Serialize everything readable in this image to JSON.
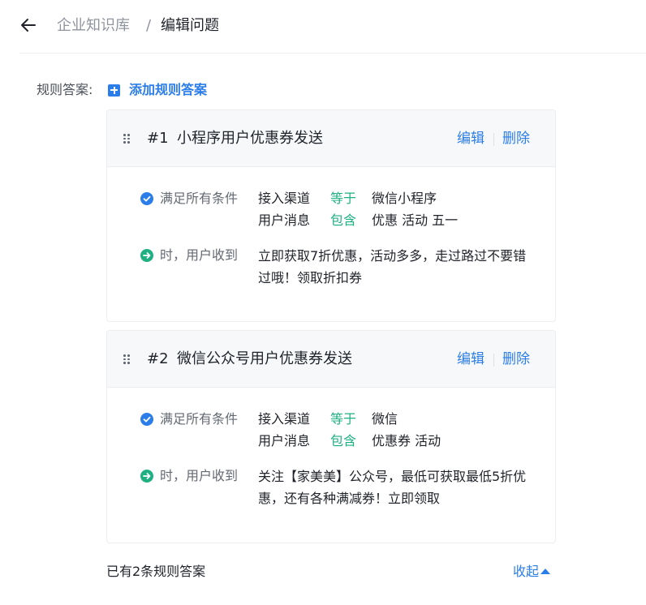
{
  "header": {
    "breadcrumb_root": "企业知识库",
    "breadcrumb_sep": "/",
    "breadcrumb_current": "编辑问题"
  },
  "rules": {
    "label": "规则答案:",
    "add_label": "添加规则答案",
    "items": [
      {
        "num": "#1",
        "title": "小程序用户优惠券发送",
        "edit_label": "编辑",
        "delete_label": "删除",
        "condition_label": "满足所有条件",
        "conditions": [
          {
            "field": "接入渠道",
            "op": "等于",
            "value": "微信小程序"
          },
          {
            "field": "用户消息",
            "op": "包含",
            "value": "优惠 活动 五一"
          }
        ],
        "reply_label": "时，用户收到",
        "reply_text": "立即获取7折优惠，活动多多，走过路过不要错过哦！领取折扣券"
      },
      {
        "num": "#2",
        "title": "微信公众号用户优惠券发送",
        "edit_label": "编辑",
        "delete_label": "删除",
        "condition_label": "满足所有条件",
        "conditions": [
          {
            "field": "接入渠道",
            "op": "等于",
            "value": "微信"
          },
          {
            "field": "用户消息",
            "op": "包含",
            "value": "优惠券 活动"
          }
        ],
        "reply_label": "时，用户收到",
        "reply_text": "关注【家美美】公众号，最低可获取最低5折优惠，还有各种满减券！立即领取"
      }
    ]
  },
  "footer": {
    "count_text": "已有2条规则答案",
    "collapse_label": "收起"
  },
  "colors": {
    "accent": "#2b7de9",
    "success": "#1fb082",
    "text": "#1f2329",
    "muted": "#8f959e"
  }
}
